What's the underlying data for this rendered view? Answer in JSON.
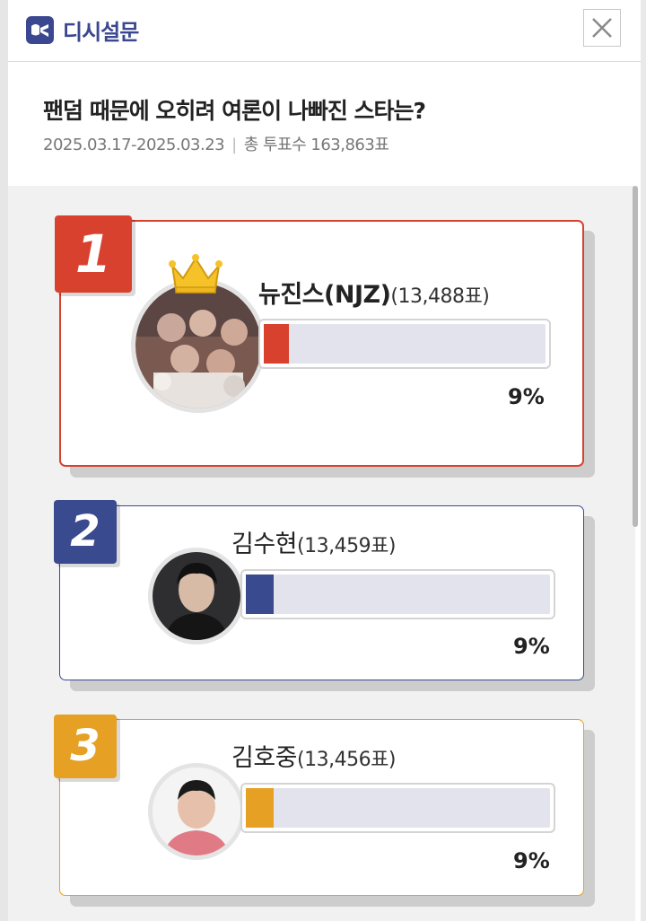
{
  "header": {
    "brand": "디시설문",
    "logo_icon": "dc-logo-icon",
    "close_icon": "close-icon"
  },
  "poll": {
    "title": "팬덤 때문에 오히려 여론이 나빠진 스타는?",
    "period": "2025.03.17-2025.03.23",
    "total_label": "총 투표수 163,863표"
  },
  "results": [
    {
      "rank": "1",
      "name": "뉴진스(NJZ)",
      "votes": "(13,488표)",
      "percent": "9%",
      "share": 0.09,
      "color": "#d9412f"
    },
    {
      "rank": "2",
      "name": "김수현",
      "votes": "(13,459표)",
      "percent": "9%",
      "share": 0.09,
      "color": "#3a4a8e"
    },
    {
      "rank": "3",
      "name": "김호중",
      "votes": "(13,456표)",
      "percent": "9%",
      "share": 0.09,
      "color": "#e6a023"
    }
  ]
}
